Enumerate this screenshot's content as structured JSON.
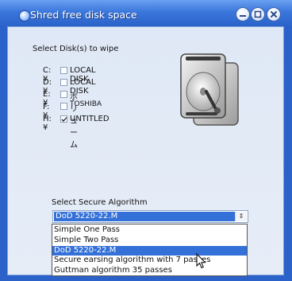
{
  "window": {
    "title": "Shred free disk space",
    "buttons": [
      "minimize",
      "maximize",
      "close"
    ]
  },
  "disks": {
    "heading": "Select Disk(s) to wipe",
    "items": [
      {
        "drive": "C:¥",
        "name": "LOCAL DISK",
        "checked": false
      },
      {
        "drive": "D:¥",
        "name": "LOCAL DISK",
        "checked": false
      },
      {
        "drive": "E:¥",
        "name": "ボリューム",
        "checked": false
      },
      {
        "drive": "F:¥",
        "name": "TOSHIBA",
        "checked": false
      },
      {
        "drive": "H:¥",
        "name": "UNTITLED",
        "checked": true
      }
    ]
  },
  "algorithm": {
    "heading": "Select Secure Algorithm",
    "selected": "DoD 5220-22.M",
    "options": [
      "Simple One Pass",
      "Simple Two Pass",
      "DoD 5220-22.M",
      "Secure earsing algorithm with 7 passes",
      "Guttman algorithm 35 passes"
    ],
    "highlighted_index": 2
  },
  "icons": {
    "title": "app-icon",
    "disk": "hard-drive-icon",
    "dropdown": "chevron-updown-icon",
    "pointer": "mouse-pointer-icon"
  },
  "colors": {
    "frame": "#2a62c9",
    "client_bg": "#e1e9f6",
    "selection": "#3370d8"
  }
}
